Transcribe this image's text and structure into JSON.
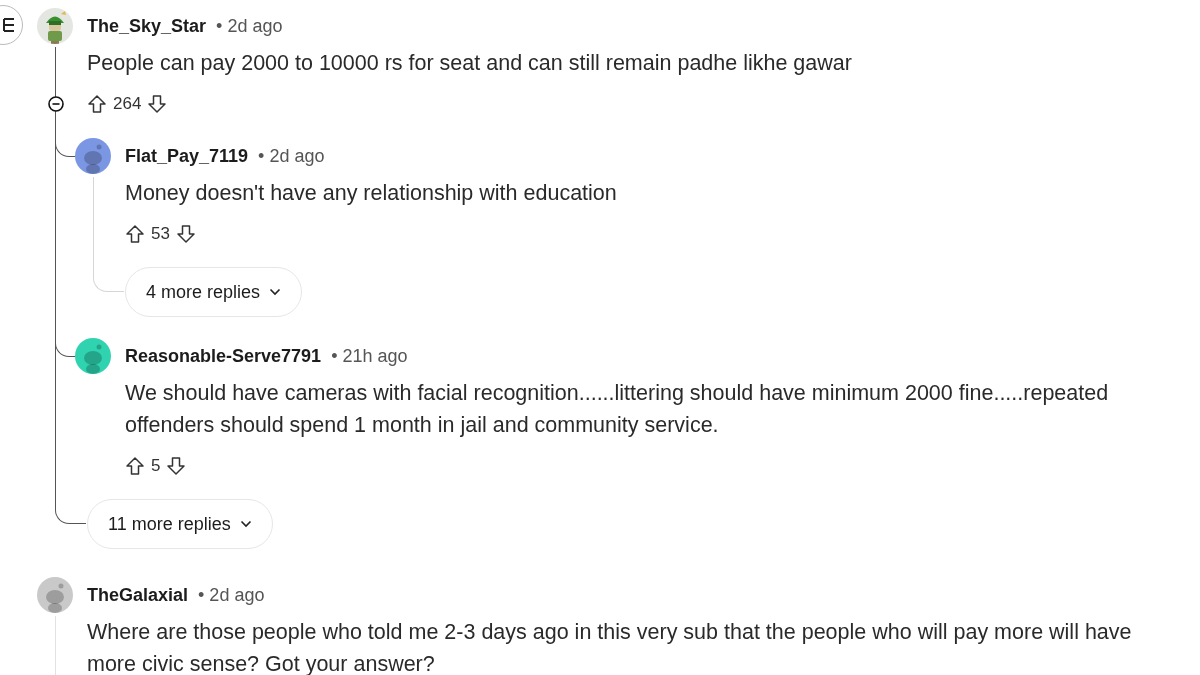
{
  "comments": [
    {
      "author": "The_Sky_Star",
      "time": "• 2d ago",
      "body": "People can pay 2000 to 10000 rs for seat and can still remain padhe likhe gawar",
      "votes": "264",
      "collapsible": true,
      "replies": [
        {
          "author": "Flat_Pay_7119",
          "time": "• 2d ago",
          "body": "Money doesn't have any relationship with education",
          "votes": "53",
          "avatar": {
            "kind": "default",
            "color": "#7b97e3"
          },
          "more_replies": "4 more replies"
        },
        {
          "author": "Reasonable-Serve7791",
          "time": "• 21h ago",
          "body": "We should have cameras with facial recognition......littering should have minimum 2000 fine.....repeated offenders should spend 1 month in jail and community service.",
          "votes": "5",
          "avatar": {
            "kind": "default",
            "color": "#2fd3b0"
          }
        }
      ],
      "more_replies": "11 more replies"
    },
    {
      "author": "TheGalaxial",
      "time": "• 2d ago",
      "body": "Where are those people who told me 2-3 days ago in this very sub that the people who will pay more will have more civic sense? Got your answer?",
      "avatar": {
        "kind": "default",
        "color": "#c9c9c9"
      }
    }
  ]
}
